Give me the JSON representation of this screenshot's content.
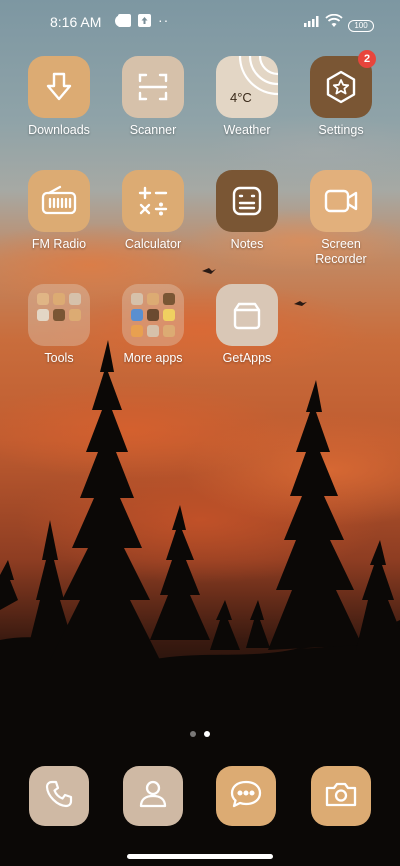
{
  "status_bar": {
    "time": "8:16 AM",
    "dots": "··",
    "battery": "100",
    "icons": [
      "weather-status-icon",
      "notification-square-icon",
      "upload-icon",
      "signal-icon",
      "wifi-icon",
      "battery-icon"
    ]
  },
  "apps": [
    {
      "label": "Downloads",
      "icon": "download-arrow-icon",
      "color": "#dcab73"
    },
    {
      "label": "Scanner",
      "icon": "scan-frame-icon",
      "color": "#d6c1aa"
    },
    {
      "label": "Weather",
      "icon": "weather-sun-icon",
      "color": "#e3d6c5",
      "temp": "4°C"
    },
    {
      "label": "Settings",
      "icon": "hexagon-star-icon",
      "color": "#7a5634",
      "badge": "2"
    },
    {
      "label": "FM Radio",
      "icon": "radio-icon",
      "color": "#dcab73"
    },
    {
      "label": "Calculator",
      "icon": "calculator-icon",
      "color": "#dcab73"
    },
    {
      "label": "Notes",
      "icon": "notes-icon",
      "color": "#7a5634"
    },
    {
      "label": "Screen\nRecorder",
      "icon": "video-camera-icon",
      "color": "#e2b07c"
    },
    {
      "label": "Tools",
      "icon": "folder-icon"
    },
    {
      "label": "More apps",
      "icon": "folder-icon"
    },
    {
      "label": "GetApps",
      "icon": "shopping-bag-icon",
      "color": "#d9c7b6"
    }
  ],
  "dock": [
    {
      "name": "phone",
      "icon": "phone-icon",
      "color": "#cfb9a4"
    },
    {
      "name": "contacts",
      "icon": "person-icon",
      "color": "#cfb9a4"
    },
    {
      "name": "messages",
      "icon": "chat-bubble-icon",
      "color": "#dcab73"
    },
    {
      "name": "camera",
      "icon": "camera-icon",
      "color": "#dcab73"
    }
  ],
  "pages": {
    "count": 2,
    "active": 2
  }
}
